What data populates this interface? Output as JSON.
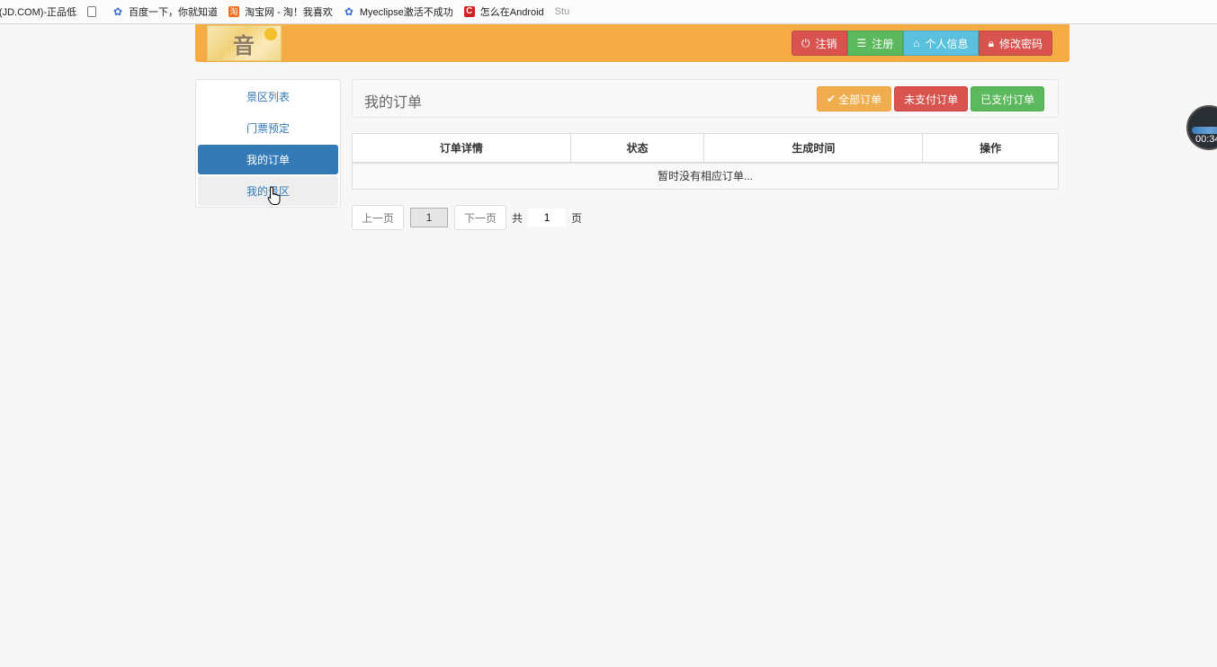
{
  "bookmarks": [
    {
      "label": "ε(JD.COM)-正品低",
      "icon": "none"
    },
    {
      "label": "",
      "icon": "page-icon"
    },
    {
      "label": "百度一下，你就知道",
      "icon": "paw-icon"
    },
    {
      "label": "淘宝网 - 淘！我喜欢",
      "icon": "taobao-icon"
    },
    {
      "label": "Myeclipse激活不成功",
      "icon": "paw-icon"
    },
    {
      "label": "怎么在Android",
      "icon": "c-icon"
    },
    {
      "label": "Stu",
      "icon": "none"
    }
  ],
  "header": {
    "logo_text": "音",
    "buttons": {
      "logout": "注销",
      "register": "注册",
      "profile": "个人信息",
      "change_password": "修改密码"
    },
    "icons": {
      "logout": "power-icon",
      "register": "list-icon",
      "profile": "home-icon",
      "change_password": "lock-icon"
    }
  },
  "sidebar": {
    "items": [
      {
        "label": "景区列表",
        "state": "normal"
      },
      {
        "label": "门票预定",
        "state": "normal"
      },
      {
        "label": "我的订单",
        "state": "active"
      },
      {
        "label": "我的景区",
        "state": "hover"
      }
    ]
  },
  "main": {
    "title": "我的订单",
    "filters": {
      "all": "全部订单",
      "unpaid": "未支付订单",
      "paid": "已支付订单"
    },
    "table": {
      "headers": [
        "订单详情",
        "状态",
        "生成时间",
        "操作"
      ],
      "empty_message": "暂时没有相应订单..."
    },
    "pager": {
      "prev": "上一页",
      "current": "1",
      "next": "下一页",
      "total_prefix": "共",
      "total": "1",
      "total_suffix": "页"
    }
  },
  "widget": {
    "time": "00:34"
  },
  "colors": {
    "header_bg": "#f5ac45",
    "primary": "#337ab7",
    "danger": "#d9534f",
    "success": "#5cb85c",
    "info": "#5bc0de",
    "warning": "#f0ad4e"
  }
}
